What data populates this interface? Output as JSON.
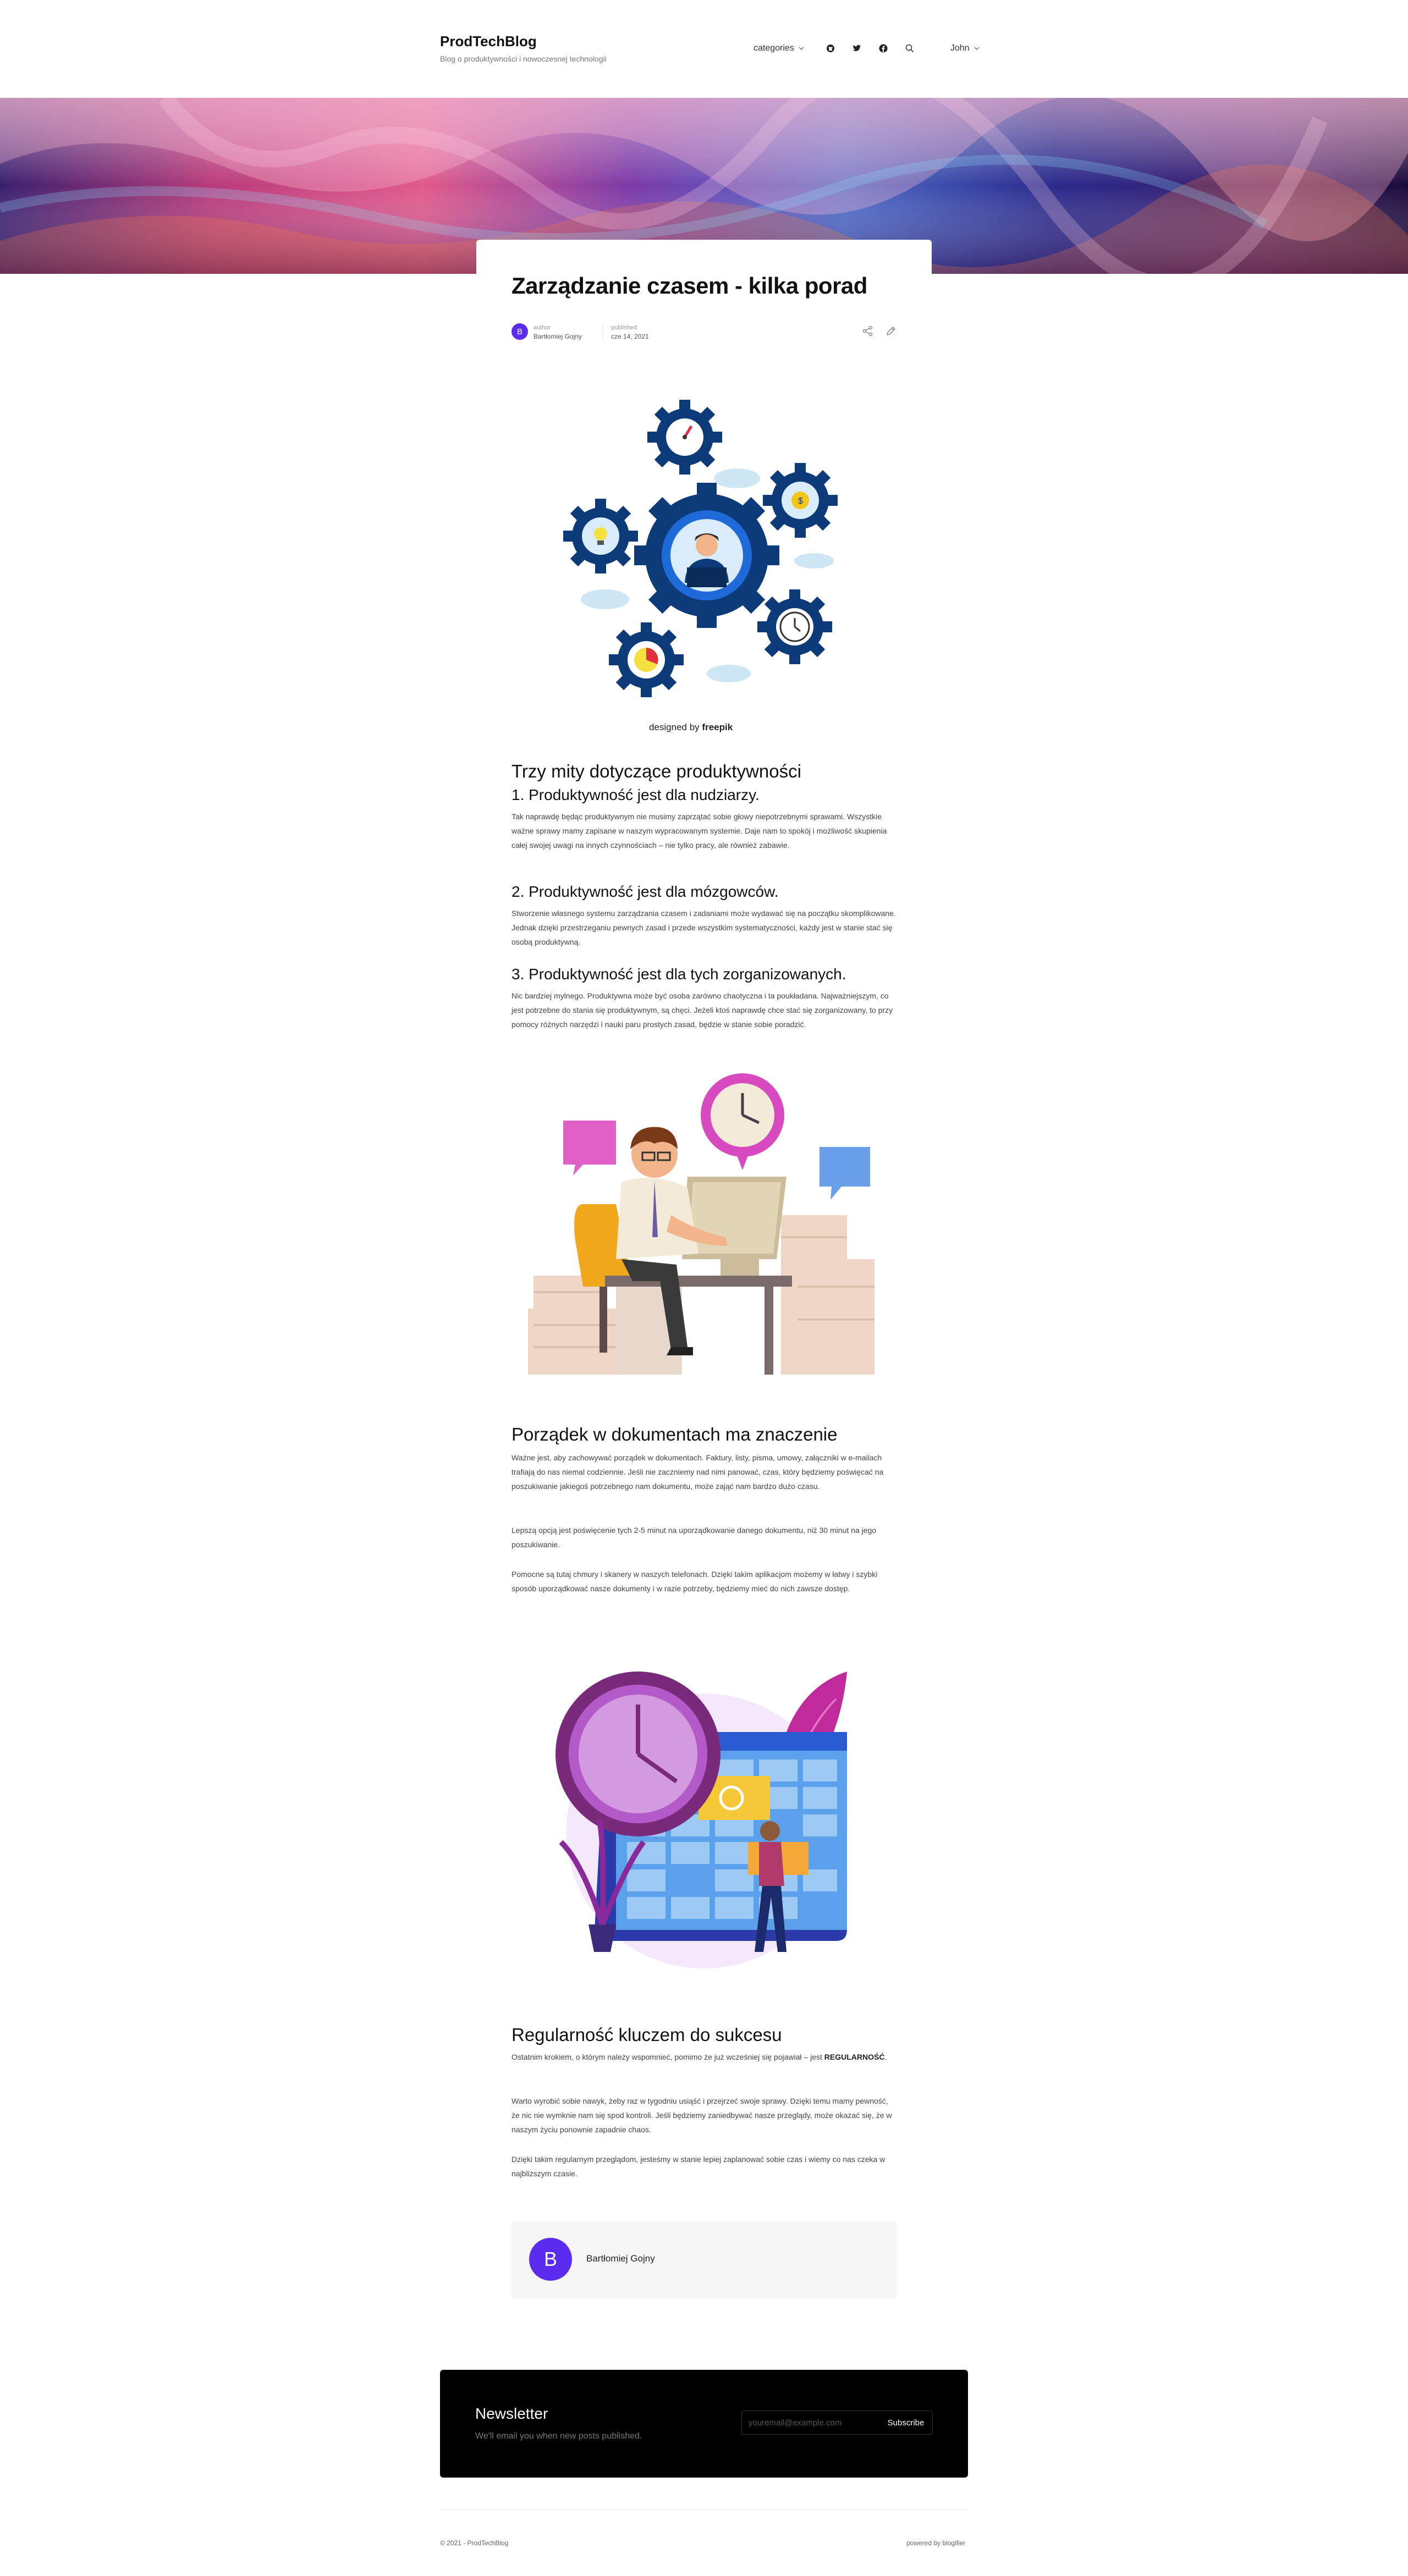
{
  "site": {
    "title": "ProdTechBlog",
    "subtitle": "Blog o produktywności i nowoczesnej technologii"
  },
  "nav": {
    "categories_label": "categories",
    "user_label": "John"
  },
  "article": {
    "title": "Zarządzanie czasem - kilka porad",
    "author_caption": "author",
    "author_name": "Bartłomiej Gojny",
    "published_caption": "published",
    "published_date": "cze 14, 2021",
    "avatar_letter": "B"
  },
  "sections": {
    "myths_heading": "Trzy mity dotyczące produktywności",
    "myth1_heading": "1. Produktywność jest dla nudziarzy.",
    "myth1_text": "Tak naprawdę będąc produktywnym nie musimy zaprzątać sobie głowy niepotrzebnymi sprawami. Wszystkie ważne sprawy mamy zapisane w naszym wypracowanym systemie. Daje nam to spokój i możliwość skupienia całej swojej uwagi na innych czynnościach – nie tylko pracy, ale również zabawie.",
    "myth2_heading": "2. Produktywność jest dla mózgowców.",
    "myth2_text": "Stworzenie własnego systemu zarządzania czasem i zadaniami może wydawać się na początku skomplikowane. Jednak dzięki przestrzeganiu pewnych zasad i przede wszystkim systematyczności, każdy jest w stanie stać się osobą produktywną.",
    "myth3_heading": "3. Produktywność jest dla tych zorganizowanych.",
    "myth3_text": "Nic bardziej mylnego. Produktywna może być osoba zarówno chaotyczna i ta poukładana. Najważniejszym, co jest potrzebne do stania się produktywnym, są chęci. Jeżeli ktoś naprawdę chce stać się zorganizowany, to przy pomocy różnych narzędzi i nauki paru prostych zasad, będzie w stanie sobie poradzić.",
    "docs_heading": "Porządek w dokumentach ma znaczenie",
    "docs_p1": "Ważne jest, aby zachowywać porządek w dokumentach. Faktury, listy, pisma, umowy, załączniki w e-mailach trafiają do nas niemal codziennie. Jeśli nie zaczniemy nad nimi panować, czas, który będziemy poświęcać na poszukiwanie jakiegoś potrzebnego nam dokumentu, może zająć nam bardzo dużo czasu.",
    "docs_p2": "Lepszą opcją jest poświęcenie tych 2-5 minut na uporządkowanie danego dokumentu, niż 30 minut na jego poszukiwanie.",
    "docs_p3": "Pomocne są tutaj chmury i skanery w naszych telefonach. Dzięki takim aplikacjom możemy w łatwy i szybki sposób uporządkować nasze dokumenty i w razie potrzeby, będziemy mieć do nich zawsze dostęp.",
    "reg_heading": "Regularność kluczem do sukcesu",
    "reg_p1_a": "Ostatnim krokiem, o którym należy wspomnieć, pomimo że już wcześniej się pojawiał – jest ",
    "reg_p1_b": "REGULARNOŚĆ",
    "reg_p1_c": ".",
    "reg_p2": "Warto wyrobić sobie nawyk, żeby raz w tygodniu usiąść i przejrzeć swoje sprawy. Dzięki temu mamy pewność, że nic nie wymknie nam się spod kontroli. Jeśli będziemy zaniedbywać nasze przeglądy, może okazać się, że w naszym życiu ponownie zapadnie chaos.",
    "reg_p3": "Dzięki takim regularnym przeglądom, jesteśmy w stanie lepiej zaplanować sobie czas i wiemy co nas czeka w najbliższym czasie."
  },
  "illustration1": {
    "credit_prefix": "designed by",
    "credit_brand": "freepik"
  },
  "author_box": {
    "letter": "B",
    "name": "Bartłomiej Gojny"
  },
  "newsletter": {
    "title": "Newsletter",
    "subtitle": "We'll email you when new posts published.",
    "placeholder": "youremail@example.com",
    "button": "Subscribe"
  },
  "footer": {
    "left": "© 2021 - ProdTechBlog",
    "right": "powered by blogifier"
  },
  "colors": {
    "accent": "#5b2bf0",
    "newsletter_bg": "#000000"
  }
}
